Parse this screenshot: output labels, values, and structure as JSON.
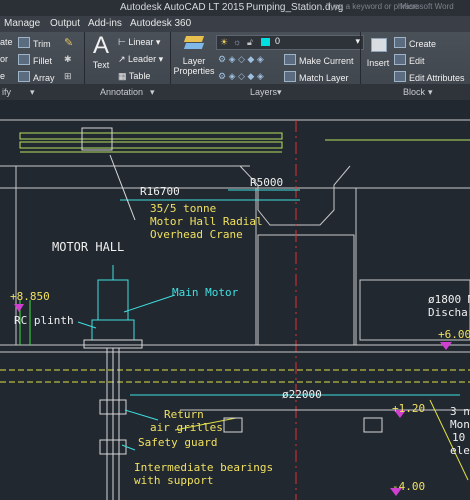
{
  "app": {
    "title": "Autodesk AutoCAD LT 2015",
    "filename": "Pumping_Station.dwg",
    "search_hint": "Type a keyword or phrase",
    "signin_hint": "Microsoft Word"
  },
  "ribbon_tabs": [
    "Manage",
    "Output",
    "Add-ins",
    "Autodesk 360"
  ],
  "modify": {
    "trim": "Trim",
    "fillet": "Fillet",
    "array": "Array",
    "left_create": "ate",
    "left_mirror": "or",
    "left_scale": "e",
    "panel_label": "ify"
  },
  "annotation": {
    "text": "Text",
    "linear": "Linear",
    "leader": "Leader",
    "table": "Table",
    "panel_label": "Annotation"
  },
  "layers": {
    "properties_line1": "Layer",
    "properties_line2": "Properties",
    "current_layer": "0",
    "make_current": "Make Current",
    "match_layer": "Match Layer",
    "panel_label": "Layers"
  },
  "block": {
    "insert": "Insert",
    "create": "Create",
    "edit": "Edit",
    "edit_attributes": "Edit Attributes",
    "panel_label": "Block"
  },
  "drawing": {
    "dim_r16700": "R16700",
    "dim_r5000": "R5000",
    "crane_line1": "35/5 tonne",
    "crane_line2": "Motor Hall Radial",
    "crane_line3": "Overhead Crane",
    "motor_hall": "MOTOR HALL",
    "level_8850": "+8.850",
    "main_motor": "Main Motor",
    "rc_plinth": "RC plinth",
    "dia_1800_line1": "ø1800 M",
    "dia_1800_line2": "Discharg",
    "level_600": "+6.00",
    "dia_22000": "ø22000",
    "level_120": "+1.20",
    "return_line1": "Return",
    "return_line2": "air grilles",
    "safety_guard": "Safety guard",
    "right_note_line1": "3 n",
    "right_note_line2": "Mon",
    "right_note_line3": "10",
    "right_note_line4": "elec",
    "intermediate_line1": "Intermediate bearings",
    "intermediate_line2": "with support",
    "level_400": "-4.00"
  }
}
